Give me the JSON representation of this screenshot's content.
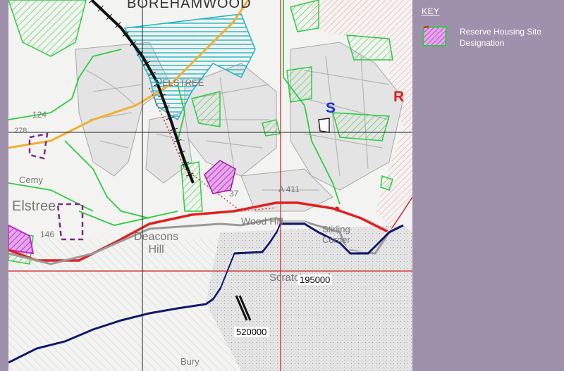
{
  "map": {
    "place_labels": {
      "borehamwood": "BOREHAMWOOD",
      "elstree_station": "ELSTREE",
      "elstree": "Elstree",
      "deacons_hill": "Deacons\nHill",
      "woodhill": "Wood Hill",
      "cemy": "Cemy",
      "stirling_corner": "Stirling\nCorner",
      "scratchwood": "Scratchwood",
      "bury": "Bury",
      "road_a411": "A 411",
      "spot_124": "124",
      "spot_146": "146",
      "spot_37": "37",
      "spot_278": "278"
    },
    "letter_markers": {
      "s": "S",
      "r": "R"
    },
    "grid_labels": {
      "northing": "195000",
      "easting": "520000"
    },
    "colors": {
      "boundary_red": "#e02020",
      "settlement_green": "#2ecc40",
      "settlement_cyan": "#1fb5c4",
      "railway_black": "#111111",
      "road_orange": "#f0b030",
      "reserve_purple": "#c026d3",
      "marker_blue": "#1a2fd6",
      "marker_red": "#e02020",
      "navy_boundary": "#101a6e"
    }
  },
  "key": {
    "title": "KEY",
    "items": [
      {
        "label": "Reserve Housing Site Designation",
        "icon": "magenta-hatch-swatch"
      }
    ]
  }
}
